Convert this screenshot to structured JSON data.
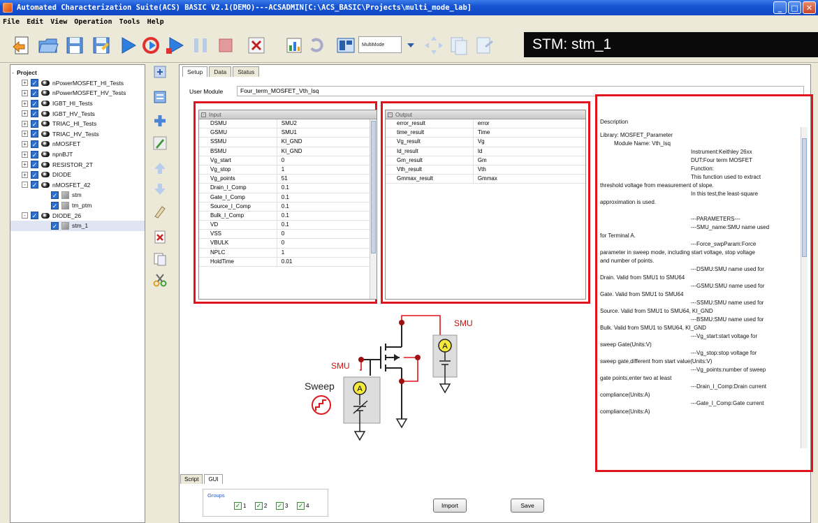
{
  "window": {
    "title": "Automated Characterization Suite(ACS) BASIC V2.1(DEMO)---ACSADMIN[C:\\ACS_BASIC\\Projects\\multi_mode_lab]"
  },
  "menu": [
    "File",
    "Edit",
    "View",
    "Operation",
    "Tools",
    "Help"
  ],
  "toolbar": {
    "mode_label": "MultiMode",
    "stm_display": "STM: stm_1"
  },
  "tree": {
    "root": "Project",
    "items": [
      {
        "label": "nPowerMOSFET_HI_Tests",
        "type": "node",
        "indent": 1,
        "exp": "+"
      },
      {
        "label": "nPowerMOSFET_HV_Tests",
        "type": "node",
        "indent": 1,
        "exp": "+"
      },
      {
        "label": "IGBT_HI_Tests",
        "type": "node",
        "indent": 1,
        "exp": "+"
      },
      {
        "label": "IGBT_HV_Tests",
        "type": "node",
        "indent": 1,
        "exp": "+"
      },
      {
        "label": "TRIAC_HI_Tests",
        "type": "node",
        "indent": 1,
        "exp": "+"
      },
      {
        "label": "TRIAC_HV_Tests",
        "type": "node",
        "indent": 1,
        "exp": "+"
      },
      {
        "label": "nMOSFET",
        "type": "node",
        "indent": 1,
        "exp": "+"
      },
      {
        "label": "npnBJT",
        "type": "node",
        "indent": 1,
        "exp": "+"
      },
      {
        "label": "RESISTOR_2T",
        "type": "node",
        "indent": 1,
        "exp": "+"
      },
      {
        "label": "DIODE",
        "type": "node",
        "indent": 1,
        "exp": "+"
      },
      {
        "label": "nMOSFET_42",
        "type": "node",
        "indent": 1,
        "exp": "-"
      },
      {
        "label": "stm",
        "type": "leaf",
        "indent": 2
      },
      {
        "label": "tm_ptm",
        "type": "leaf",
        "indent": 2
      },
      {
        "label": "DIODE_26",
        "type": "node",
        "indent": 1,
        "exp": "-"
      },
      {
        "label": "stm_1",
        "type": "leaf",
        "indent": 2,
        "selected": true
      }
    ]
  },
  "tabs": [
    "Setup",
    "Data",
    "Status"
  ],
  "user_module": {
    "label": "User Module",
    "value": "Four_term_MOSFET_Vth_lsq"
  },
  "input_grid": {
    "header": "Input",
    "rows": [
      [
        "DSMU",
        "SMU2"
      ],
      [
        "GSMU",
        "SMU1"
      ],
      [
        "SSMU",
        "KI_GND"
      ],
      [
        "BSMU",
        "KI_GND"
      ],
      [
        "Vg_start",
        "0"
      ],
      [
        "Vg_stop",
        "1"
      ],
      [
        "Vg_points",
        "51"
      ],
      [
        "Drain_I_Comp",
        "0.1"
      ],
      [
        "Gate_I_Comp",
        "0.1"
      ],
      [
        "Source_I_Comp",
        "0.1"
      ],
      [
        "Bulk_I_Comp",
        "0.1"
      ],
      [
        "VD",
        "0.1"
      ],
      [
        "VSS",
        "0"
      ],
      [
        "VBULK",
        "0"
      ],
      [
        "NPLC",
        "1"
      ],
      [
        "HoldTime",
        "0.01"
      ]
    ]
  },
  "output_grid": {
    "header": "Output",
    "rows": [
      [
        "error_result",
        "error"
      ],
      [
        "time_result",
        "Time"
      ],
      [
        "Vg_result",
        "Vg"
      ],
      [
        "Id_result",
        "Id"
      ],
      [
        "Gm_result",
        "Gm"
      ],
      [
        "Vth_result",
        "Vth"
      ],
      [
        "Gmmax_result",
        "Gmmax"
      ]
    ]
  },
  "description": {
    "title": "Description",
    "lines": [
      {
        "t": "Library: MOSFET_Parameter",
        "i": 0
      },
      {
        "t": "Module Name: Vth_lsq",
        "i": 1
      },
      {
        "t": "Instrument:Keithley 26xx",
        "i": 2
      },
      {
        "t": "DUT:Four term MOSFET",
        "i": 2
      },
      {
        "t": "Function:",
        "i": 2
      },
      {
        "t": "This function used to extract",
        "i": 2
      },
      {
        "t": "threshold voltage from measurement of slope.",
        "i": 0
      },
      {
        "t": "In this test,the least-square",
        "i": 2
      },
      {
        "t": "approximation is used.",
        "i": 0
      },
      {
        "t": "",
        "i": 0
      },
      {
        "t": "---PARAMETERS---",
        "i": 2
      },
      {
        "t": "---SMU_name:SMU name used",
        "i": 2
      },
      {
        "t": "for Terminal A.",
        "i": 0
      },
      {
        "t": "---Force_swpParam:Force",
        "i": 2
      },
      {
        "t": "parameter in sweep mode, including start voltage, stop voltage",
        "i": 0
      },
      {
        "t": "and number of points.",
        "i": 0
      },
      {
        "t": "---DSMU:SMU name used for",
        "i": 2
      },
      {
        "t": "Drain. Valid from SMU1 to SMU64",
        "i": 0
      },
      {
        "t": "---GSMU:SMU name used for",
        "i": 2
      },
      {
        "t": "Gate. Valid from SMU1 to SMU64",
        "i": 0
      },
      {
        "t": "---SSMU:SMU name used for",
        "i": 2
      },
      {
        "t": "Source. Valid from SMU1 to SMU64, KI_GND",
        "i": 0
      },
      {
        "t": "---BSMU:SMU name used for",
        "i": 2
      },
      {
        "t": "Bulk. Valid from SMU1 to SMU64, KI_GND",
        "i": 0
      },
      {
        "t": "---Vg_start:start voltage for",
        "i": 2
      },
      {
        "t": "sweep Gate(Units:V)",
        "i": 0
      },
      {
        "t": "---Vg_stop:stop voltage for",
        "i": 2
      },
      {
        "t": "sweep gate,different from start value(Units:V)",
        "i": 0
      },
      {
        "t": "---Vg_points:number of sweep",
        "i": 2
      },
      {
        "t": "gate points,enter two at least",
        "i": 0
      },
      {
        "t": "---Drain_I_Comp:Drain current",
        "i": 2
      },
      {
        "t": "compliance(Units:A)",
        "i": 0
      },
      {
        "t": "---Gate_I_Comp:Gate current",
        "i": 2
      },
      {
        "t": "compliance(Units:A)",
        "i": 0
      }
    ]
  },
  "diagram": {
    "smu_top": "SMU",
    "smu_left": "SMU",
    "sweep": "Sweep",
    "ammeter": "A"
  },
  "bottom": {
    "tabs": [
      "Script",
      "GUI"
    ],
    "groups_label": "Groups",
    "groups": [
      "1",
      "2",
      "3",
      "4"
    ],
    "import_label": "Import",
    "save_label": "Save"
  },
  "colors": {
    "highlight": "#e0141c",
    "title_bar": "#1654d4",
    "wire": "#e0141c"
  }
}
